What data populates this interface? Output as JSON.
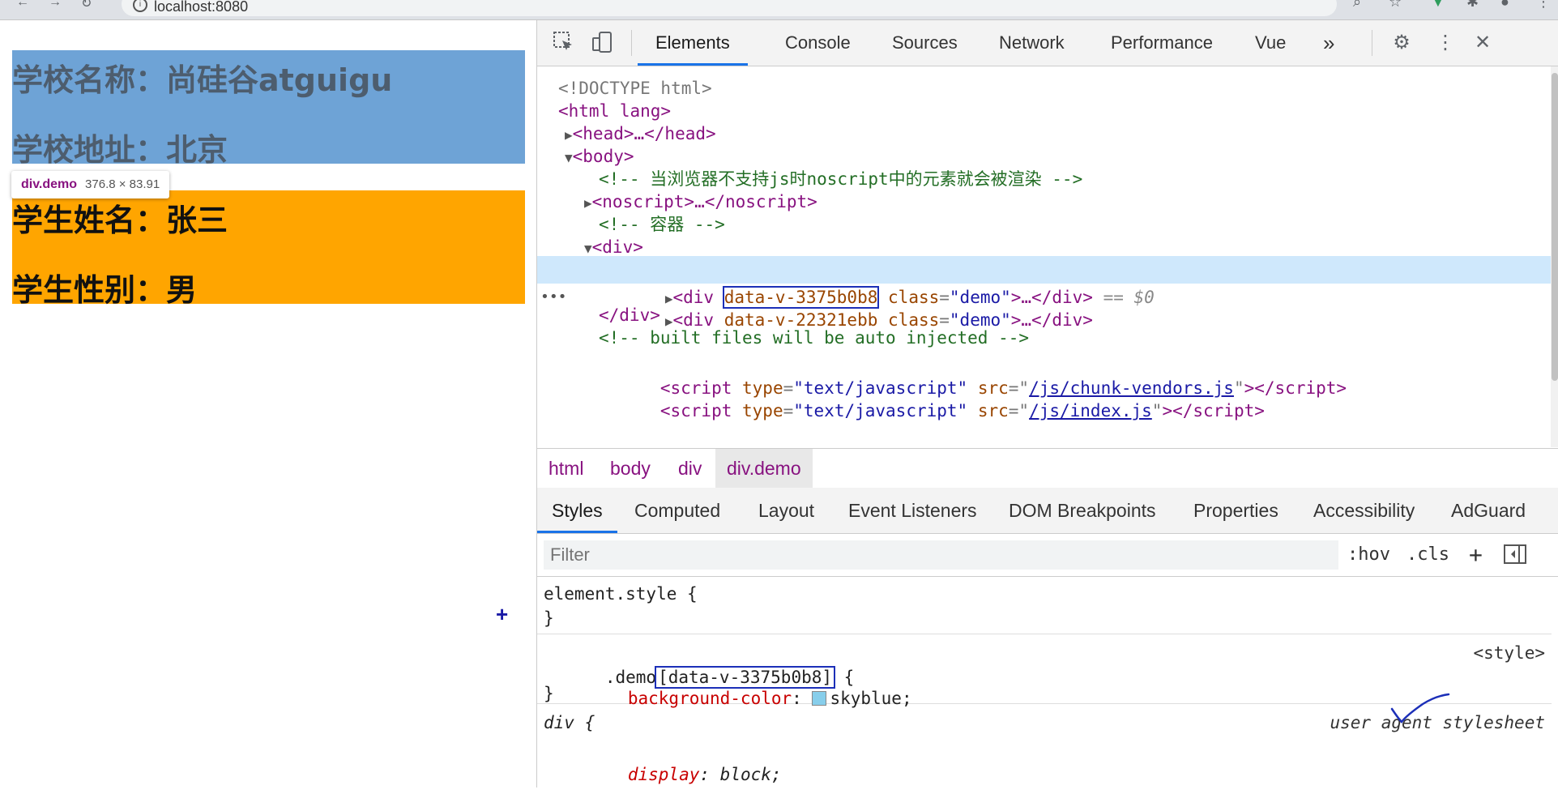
{
  "browser": {
    "url": "localhost:8080"
  },
  "page": {
    "school_name": "学校名称：尚硅谷atguigu",
    "school_address": "学校地址：北京",
    "student_name": "学生姓名：张三",
    "student_gender": "学生性别：男",
    "tooltip_tag": "div.demo",
    "tooltip_dims": "376.8 × 83.91",
    "plus_marker": "+"
  },
  "devtools": {
    "tabs": [
      "Elements",
      "Console",
      "Sources",
      "Network",
      "Performance",
      "Vue",
      "»"
    ],
    "dom": {
      "doctype": "<!DOCTYPE html>",
      "html_open": "<html lang>",
      "head": "<head>…</head>",
      "body_open": "<body>",
      "comment1": "<!-- 当浏览器不支持js时noscript中的元素就会被渲染 -->",
      "noscript": "<noscript>…</noscript>",
      "comment2": "<!-- 容器 -->",
      "div_open": "<div>",
      "sel_attr": "data-v-3375b0b8",
      "sel_suffix": "== $0",
      "div2_attr": "data-v-22321ebb",
      "class_attr": "class",
      "class_val": "\"demo\"",
      "div_close": "</div>",
      "comment3": "<!-- built files will be auto injected -->",
      "script_type_val": "\"text/javascript\"",
      "script1_src": "/js/chunk-vendors.js",
      "script2_src": "/js/index.js"
    },
    "breadcrumbs": [
      "html",
      "body",
      "div",
      "div.demo"
    ],
    "panel_tabs": [
      "Styles",
      "Computed",
      "Layout",
      "Event Listeners",
      "DOM Breakpoints",
      "Properties",
      "Accessibility",
      "AdGuard"
    ],
    "filter": {
      "placeholder": "Filter",
      "hov": ":hov",
      "cls": ".cls",
      "plus": "+"
    },
    "styles": {
      "element_style": "element.style {",
      "close_brace": "}",
      "rule1_selector_prefix": ".demo",
      "rule1_attr": "[data-v-3375b0b8]",
      "rule1_open": " {",
      "rule1_source": "<style>",
      "rule1_prop": "background-color",
      "rule1_value": "skyblue",
      "rule2_selector": "div {",
      "rule2_source": "user agent stylesheet",
      "rule2_prop": "display",
      "rule2_value": "block"
    }
  }
}
